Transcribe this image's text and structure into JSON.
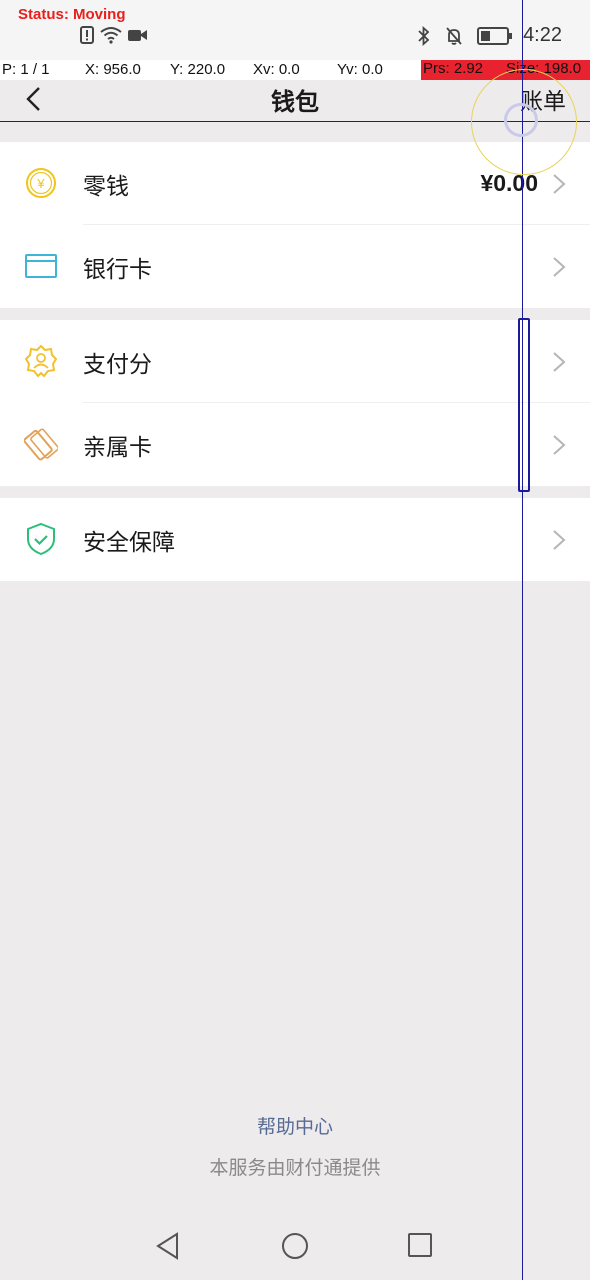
{
  "status_bar": {
    "debug_status": "Status: Moving",
    "time": "4:22",
    "icons": [
      "alert-icon",
      "wifi-icon",
      "video-icon",
      "bluetooth-icon",
      "mute-icon",
      "battery-icon"
    ]
  },
  "pointer_info": {
    "p": "P: 1 / 1",
    "x": "X: 956.0",
    "y": "Y: 220.0",
    "xv": "Xv: 0.0",
    "yv": "Yv: 0.0",
    "prs": "Prs: 2.92",
    "size": "Size: 198.0"
  },
  "header": {
    "title": "钱包",
    "bill_label": "账单"
  },
  "groups": [
    {
      "items": [
        {
          "label": "零钱",
          "value": "¥0.00",
          "icon": "coin-icon"
        },
        {
          "label": "银行卡",
          "value": "",
          "icon": "bank-card-icon"
        }
      ]
    },
    {
      "items": [
        {
          "label": "支付分",
          "value": "",
          "icon": "pay-score-icon"
        },
        {
          "label": "亲属卡",
          "value": "",
          "icon": "family-card-icon"
        }
      ]
    },
    {
      "items": [
        {
          "label": "安全保障",
          "value": "",
          "icon": "shield-icon"
        }
      ]
    }
  ],
  "footer": {
    "help_link": "帮助中心",
    "provider_note": "本服务由财付通提供"
  },
  "colors": {
    "page_bg": "#edebeb",
    "link": "#576b95",
    "coin": "#f0c419",
    "bank_card": "#3eb4d6",
    "pay_score": "#f2c12e",
    "family_card": "#e3a25a",
    "shield": "#2bbf7a",
    "debug_red": "#e8232f",
    "crosshair": "#1a1a9a"
  }
}
